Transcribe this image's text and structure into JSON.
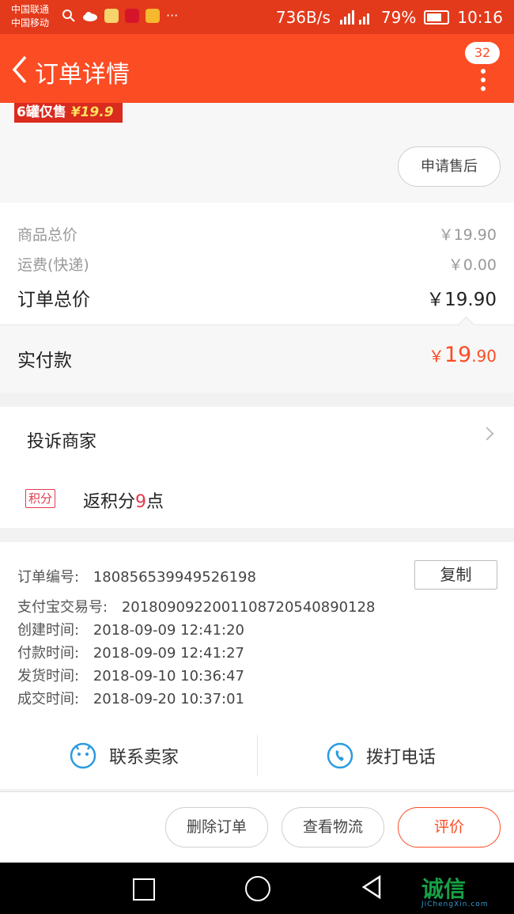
{
  "status_bar": {
    "carrier_1": "中国联通",
    "carrier_2": "中国移动",
    "speed": "736B/s",
    "network": "4G",
    "battery": "79%",
    "time": "10:16"
  },
  "header": {
    "title": "订单详情",
    "badge_count": "32"
  },
  "promo": {
    "text": "6罐仅售",
    "price": "¥19.9"
  },
  "after_sale_button": "申请售后",
  "prices": {
    "goods_total_label": "商品总价",
    "goods_total_value": "￥19.90",
    "shipping_label": "运费(快递)",
    "shipping_value": "￥0.00",
    "order_total_label": "订单总价",
    "order_total_value": "￥19.90",
    "paid_label": "实付款",
    "paid_symbol": "￥",
    "paid_integer": "19",
    "paid_decimal": ".90"
  },
  "complain": {
    "label": "投诉商家"
  },
  "points": {
    "tag": "积分",
    "prefix": "返积分",
    "value": "9",
    "suffix": "点"
  },
  "order_info": {
    "order_no_label": "订单编号:",
    "order_no": "180856539949526198",
    "copy_button": "复制",
    "alipay_label": "支付宝交易号:",
    "alipay_no": "2018090922001108720540890128",
    "created_label": "创建时间:",
    "created": "2018-09-09 12:41:20",
    "paid_label": "付款时间:",
    "paid": "2018-09-09 12:41:27",
    "shipped_label": "发货时间:",
    "shipped": "2018-09-10 10:36:47",
    "completed_label": "成交时间:",
    "completed": "2018-09-20 10:37:01"
  },
  "contact": {
    "seller_label": "联系卖家",
    "call_label": "拨打电话"
  },
  "actions": {
    "delete": "删除订单",
    "logistics": "查看物流",
    "review": "评价"
  },
  "watermark": {
    "text": "诚信",
    "sub": "JiChengXin.com"
  },
  "colors": {
    "header": "#fb4c24",
    "status_bar": "#e33a1b",
    "accent": "#fb4c24",
    "points": "#e33a4d"
  }
}
